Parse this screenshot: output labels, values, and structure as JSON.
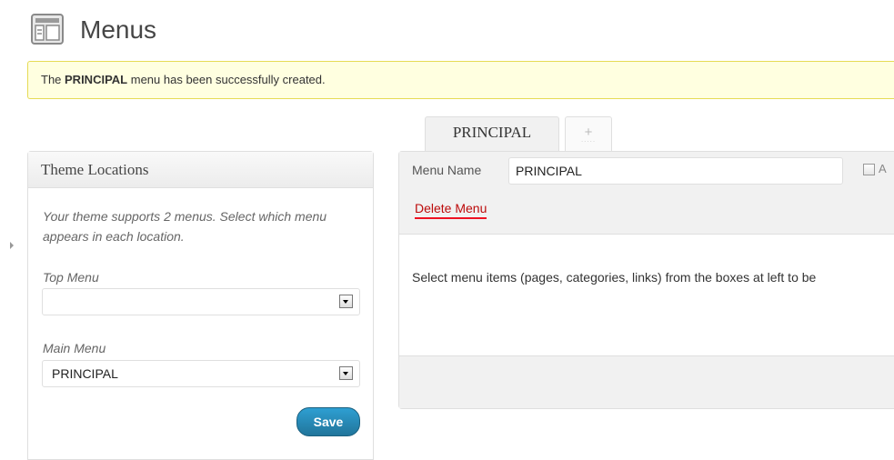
{
  "page": {
    "title": "Menus"
  },
  "notice": {
    "prefix": "The ",
    "menu_name": "PRINCIPAL",
    "suffix": " menu has been successfully created."
  },
  "tabs": [
    {
      "label": "PRINCIPAL",
      "active": true
    },
    {
      "label": "+",
      "active": false
    }
  ],
  "theme_locations": {
    "title": "Theme Locations",
    "description": "Your theme supports 2 menus. Select which menu appears in each location.",
    "locations": [
      {
        "label": "Top Menu",
        "selected": ""
      },
      {
        "label": "Main Menu",
        "selected": "PRINCIPAL"
      }
    ],
    "save_label": "Save"
  },
  "menu_editor": {
    "name_label": "Menu Name",
    "name_value": "PRINCIPAL",
    "auto_add_label": "A",
    "delete_label": "Delete Menu",
    "instructions": "Select menu items (pages, categories, links) from the boxes at left to be"
  },
  "colors": {
    "notice_bg": "#ffffe0",
    "notice_border": "#e6db55",
    "save_button": "#21759b",
    "delete_link": "#bc0b0b"
  },
  "icons": [
    "menus-page-icon",
    "dropdown-arrow-icon",
    "collapse-arrow-icon"
  ]
}
